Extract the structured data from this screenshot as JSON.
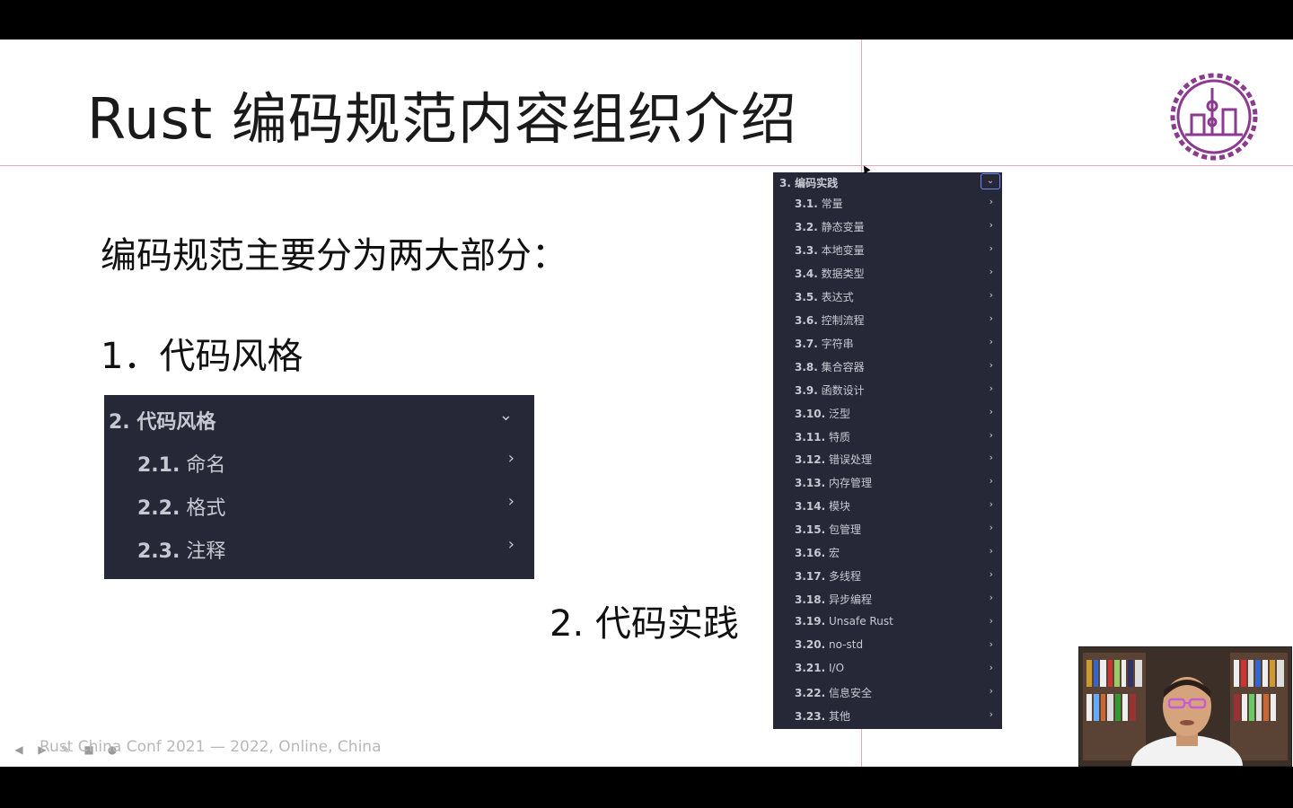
{
  "slide": {
    "title": "Rust 编码规范内容组织介绍",
    "intro": "编码规范主要分为两大部分：",
    "part1_label": "1．代码风格",
    "part2_label": "2. 代码实践",
    "footer": "Rust China Conf 2021 — 2022, Online, China"
  },
  "toc_style": {
    "header": "2. 代码风格",
    "items": [
      {
        "num": "2.1.",
        "label": "命名"
      },
      {
        "num": "2.2.",
        "label": "格式"
      },
      {
        "num": "2.3.",
        "label": "注释"
      }
    ]
  },
  "toc_practice": {
    "header": "3. 编码实践",
    "items": [
      {
        "num": "3.1.",
        "label": "常量"
      },
      {
        "num": "3.2.",
        "label": "静态变量"
      },
      {
        "num": "3.3.",
        "label": "本地变量"
      },
      {
        "num": "3.4.",
        "label": "数据类型"
      },
      {
        "num": "3.5.",
        "label": "表达式"
      },
      {
        "num": "3.6.",
        "label": "控制流程"
      },
      {
        "num": "3.7.",
        "label": "字符串"
      },
      {
        "num": "3.8.",
        "label": "集合容器"
      },
      {
        "num": "3.9.",
        "label": "函数设计"
      },
      {
        "num": "3.10.",
        "label": "泛型"
      },
      {
        "num": "3.11.",
        "label": "特质"
      },
      {
        "num": "3.12.",
        "label": "错误处理"
      },
      {
        "num": "3.13.",
        "label": "内存管理"
      },
      {
        "num": "3.14.",
        "label": "模块"
      },
      {
        "num": "3.15.",
        "label": "包管理"
      },
      {
        "num": "3.16.",
        "label": "宏"
      },
      {
        "num": "3.17.",
        "label": "多线程"
      },
      {
        "num": "3.18.",
        "label": "异步编程"
      },
      {
        "num": "3.19.",
        "label": "Unsafe Rust"
      },
      {
        "num": "3.20.",
        "label": "no-std"
      },
      {
        "num": "3.21.",
        "label": "I/O"
      },
      {
        "num": "3.22.",
        "label": "信息安全"
      },
      {
        "num": "3.23.",
        "label": "其他"
      }
    ]
  },
  "colors": {
    "panel_bg": "#262837",
    "panel_text": "#c7c9d2",
    "guide_line": "#e8a9b3",
    "logo": "#8b3a8f"
  },
  "icons": {
    "logo": "conference-emblem-icon",
    "webcam": "webcam-presenter-video"
  }
}
